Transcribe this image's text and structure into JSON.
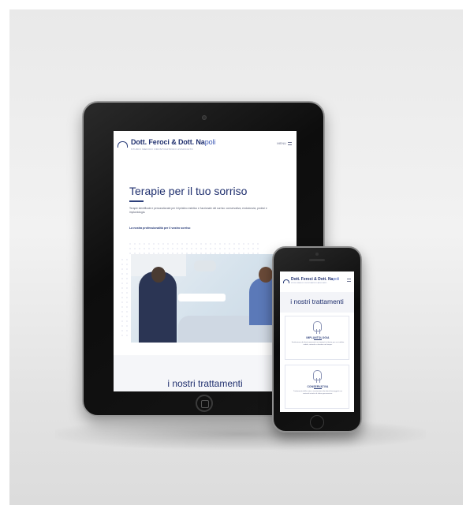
{
  "tablet": {
    "header": {
      "logo_name": "Dott. Feroci & Dott. Na",
      "logo_name_accent": "poli",
      "logo_tagline": "STUDIO MEDICO ODONTOIATRICO ASSOCIATO",
      "menu_label": "MENU"
    },
    "hero": {
      "title": "Terapie per il tuo sorriso",
      "body": "Terapie identificate e personalizzate per il ripristino estetico e funzionale del sorriso: conservativa, endodonzia, protesi e implantologia.",
      "highlight": "La nostra professionalità per il vostro sorriso"
    },
    "section_title": "i nostri trattamenti"
  },
  "phone": {
    "header": {
      "logo_name": "Dott. Feroci & Dott. Na",
      "logo_name_accent": "poli",
      "logo_tagline": "STUDIO MEDICO ODONTOIATRICO ASSOCIATO"
    },
    "section_title": "i nostri trattamenti",
    "cards": [
      {
        "title": "IMPLANTOLOGIA",
        "text": "Sostituzione dei denti mancanti con impianti in titanio per un risultato stabile, naturale e duraturo nel tempo."
      },
      {
        "title": "CONSERVATIVA",
        "text": "Trattamento delle carie e ricostruzione dei denti danneggiati con materiali estetici di ultima generazione."
      }
    ]
  },
  "colors": {
    "brand_navy": "#1f2f6e",
    "brand_blue": "#3d59b5",
    "device_black": "#111111",
    "backdrop": "#ececec"
  }
}
